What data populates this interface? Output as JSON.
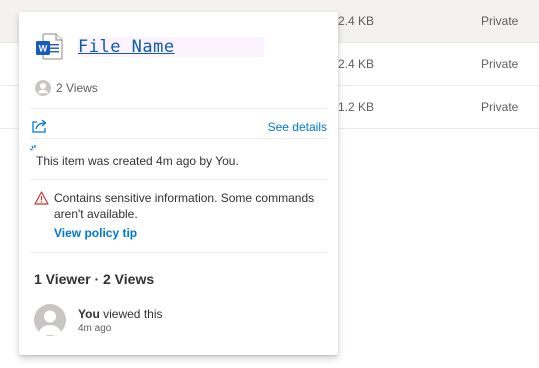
{
  "file_list": {
    "rows": [
      {
        "size": "2.4 KB",
        "access": "Private"
      },
      {
        "size": "2.4 KB",
        "access": "Private"
      },
      {
        "size": "1.2 KB",
        "access": "Private"
      }
    ]
  },
  "card": {
    "file_icon": "word-document-icon",
    "file_name": "File Name",
    "views_summary": "2 Views",
    "see_details": "See details",
    "created_text": "This item was created 4m ago by You.",
    "warning_text": "Contains sensitive information. Some commands aren't available.",
    "policy_link": "View policy tip",
    "viewers_heading": "1 Viewer · 2 Views",
    "viewer": {
      "name": "You",
      "action": "viewed this",
      "time": "4m ago"
    }
  },
  "colors": {
    "accent": "#0078d4",
    "warning": "#d13438",
    "word_blue": "#185abd"
  }
}
